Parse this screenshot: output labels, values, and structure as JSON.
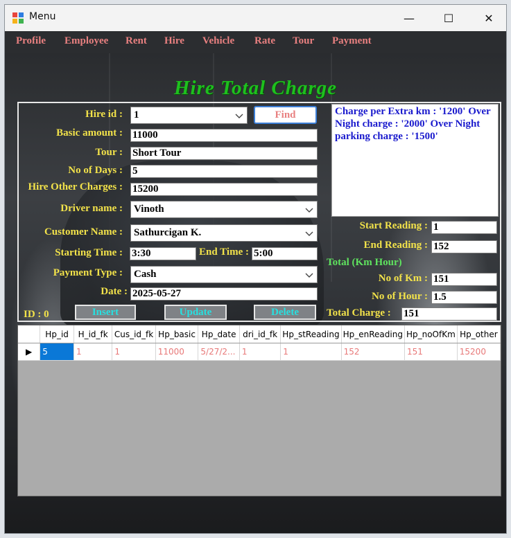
{
  "window": {
    "title": "Menu",
    "minimize_glyph": "—",
    "maximize_glyph": "☐",
    "close_glyph": "✕"
  },
  "menu": [
    "Profile",
    "Employee",
    "Rent",
    "Hire",
    "Vehicle",
    "Rate",
    "Tour",
    "Payment"
  ],
  "heading": "Hire Total Charge",
  "form": {
    "hire_id_label": "Hire id :",
    "hire_id_value": "1",
    "find_label": "Find",
    "basic_amount_label": "Basic amount :",
    "basic_amount_value": "11000",
    "tour_label": "Tour :",
    "tour_value": "Short Tour",
    "no_of_days_label": "No of Days :",
    "no_of_days_value": "5",
    "hire_other_label": "Hire Other Charges :",
    "hire_other_value": "15200",
    "driver_label": "Driver name :",
    "driver_value": "Vinoth",
    "customer_label": "Customer Name :",
    "customer_value": "Sathurcigan K.",
    "starting_time_label": "Starting Time :",
    "starting_time_value": "3:30",
    "end_time_label": "End Time :",
    "end_time_value": "5:00",
    "payment_type_label": "Payment Type :",
    "payment_type_value": "Cash",
    "date_label": "Date :",
    "date_value": "2025-05-27",
    "id_label": "ID : 0",
    "insert_label": "Insert",
    "update_label": "Update",
    "delete_label": "Delete"
  },
  "info_text": "Charge per Extra km : '1200' Over Night charge : '2000' Over Night parking charge : '1500'",
  "readings": {
    "start_label": "Start Reading :",
    "start_value": "1",
    "end_label": "End Reading :",
    "end_value": "152",
    "total_km_hour_label": "Total (Km  Hour)",
    "no_of_km_label": "No of Km :",
    "no_of_km_value": "151",
    "no_of_hour_label": "No of Hour :",
    "no_of_hour_value": "1.5",
    "total_charge_label": "Total Charge :",
    "total_charge_value": "151"
  },
  "grid": {
    "columns": [
      "Hp_id",
      "H_id_fk",
      "Cus_id_fk",
      "Hp_basic",
      "Hp_date",
      "dri_id_fk",
      "Hp_stReading",
      "Hp_enReading",
      "Hp_noOfKm",
      "Hp_other"
    ],
    "rows": [
      [
        "5",
        "1",
        "1",
        "11000",
        "5/27/2...",
        "1",
        "1",
        "152",
        "151",
        "15200"
      ]
    ],
    "row_marker": "▶"
  }
}
